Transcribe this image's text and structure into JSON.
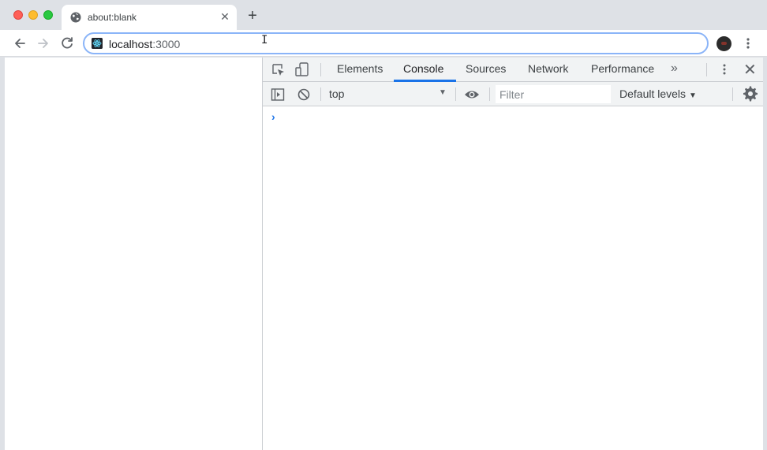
{
  "browser": {
    "tab": {
      "title": "about:blank",
      "close_glyph": "✕",
      "icon": "globe-icon"
    },
    "new_tab_glyph": "+",
    "address": {
      "host": "localhost",
      "port": ":3000"
    },
    "cursor_glyph": "I"
  },
  "devtools": {
    "tabs": [
      {
        "label": "Elements"
      },
      {
        "label": "Console"
      },
      {
        "label": "Sources"
      },
      {
        "label": "Network"
      },
      {
        "label": "Performance"
      }
    ],
    "active_tab": "Console",
    "more_tabs_glyph": "»",
    "close_glyph": "✕",
    "console": {
      "context": "top",
      "context_arrow": "▼",
      "filter_placeholder": "Filter",
      "levels": "Default levels",
      "levels_arrow": "▼",
      "prompt": "›"
    }
  },
  "colors": {
    "accent": "#1a73e8",
    "tabstrip": "#dee1e6",
    "omnibox_focus": "#8ab4f8"
  }
}
